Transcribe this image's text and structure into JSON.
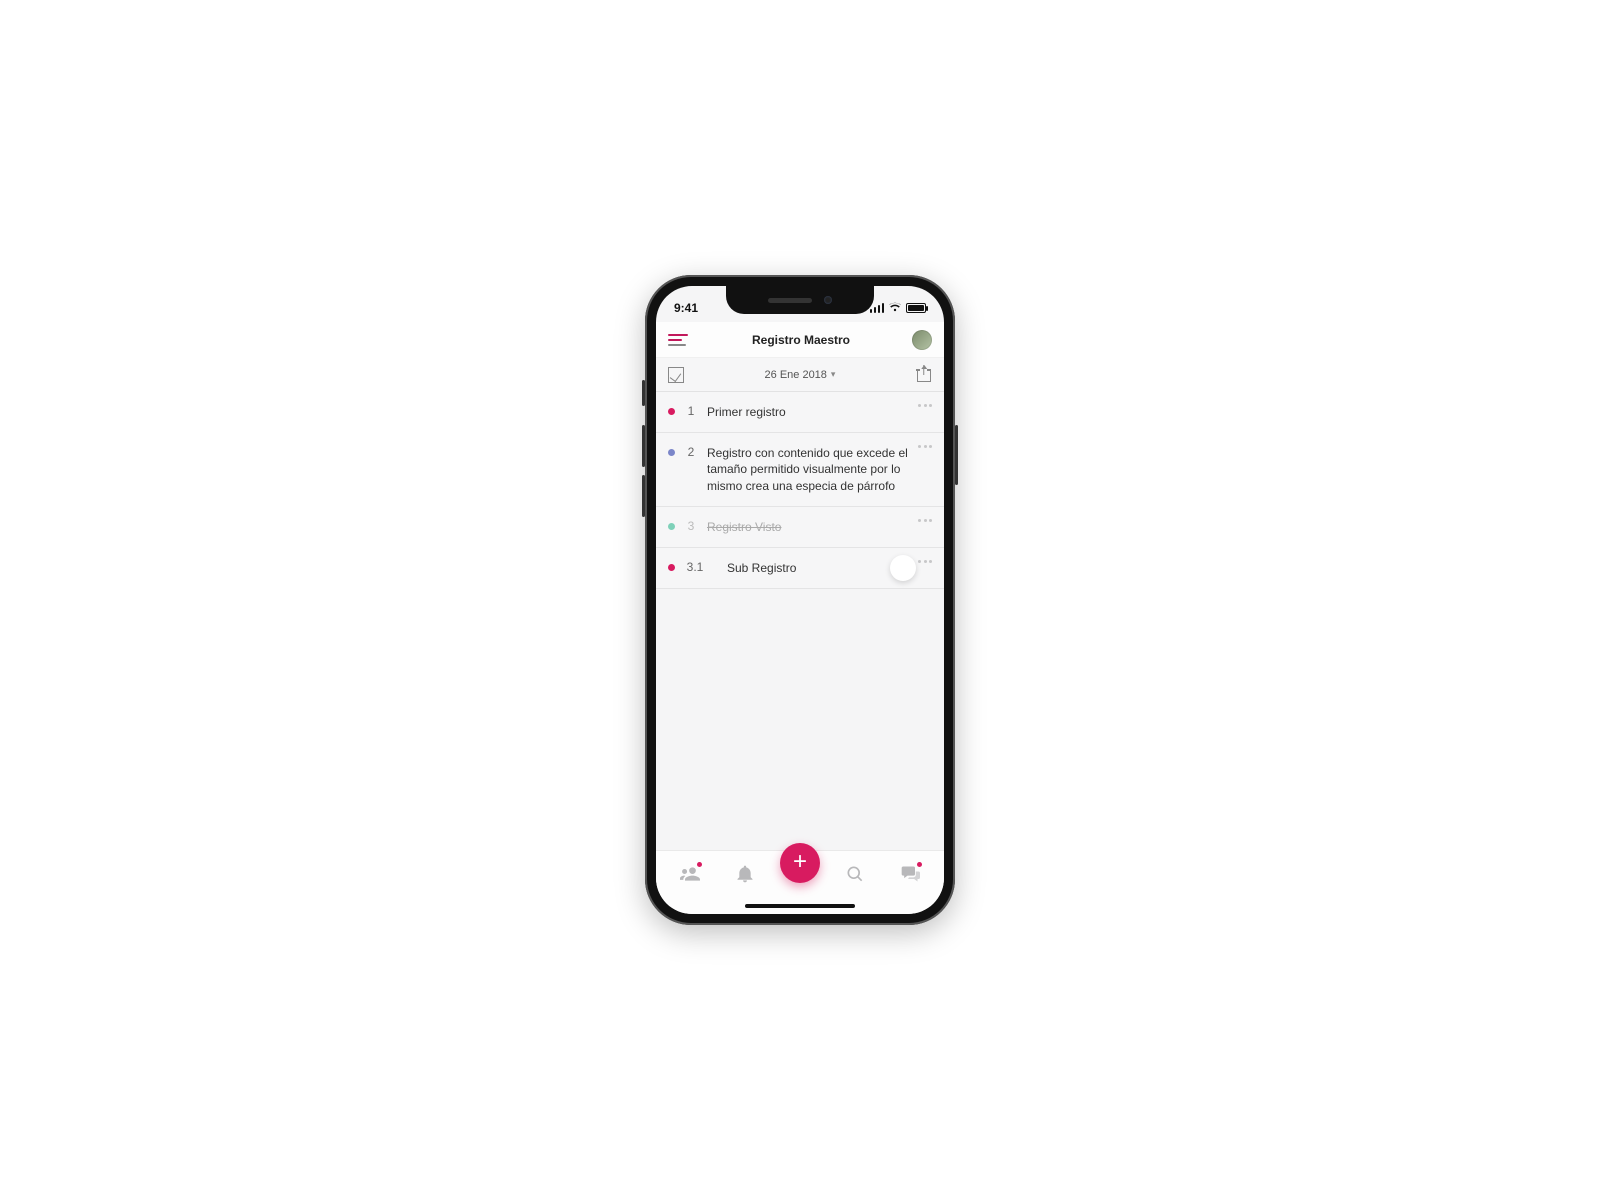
{
  "status": {
    "time": "9:41"
  },
  "nav": {
    "title": "Registro Maestro"
  },
  "toolbar": {
    "date": "26 Ene 2018"
  },
  "entries": [
    {
      "num": "1",
      "text": "Primer registro",
      "dot": "#d81b60",
      "done": false,
      "sub": false
    },
    {
      "num": "2",
      "text": "Registro con contenido que excede el tamaño permitido visualmente por lo mismo crea una especia de párrofo",
      "dot": "#7b86c9",
      "done": false,
      "sub": false
    },
    {
      "num": "3",
      "text": "Registro Visto",
      "dot": "#7fd1b9",
      "done": true,
      "sub": false
    },
    {
      "num": "3.1",
      "text": "Sub Registro",
      "dot": "#d81b60",
      "done": false,
      "sub": true
    }
  ],
  "fab": {
    "label": "+"
  },
  "colors": {
    "accent": "#d81b60"
  }
}
